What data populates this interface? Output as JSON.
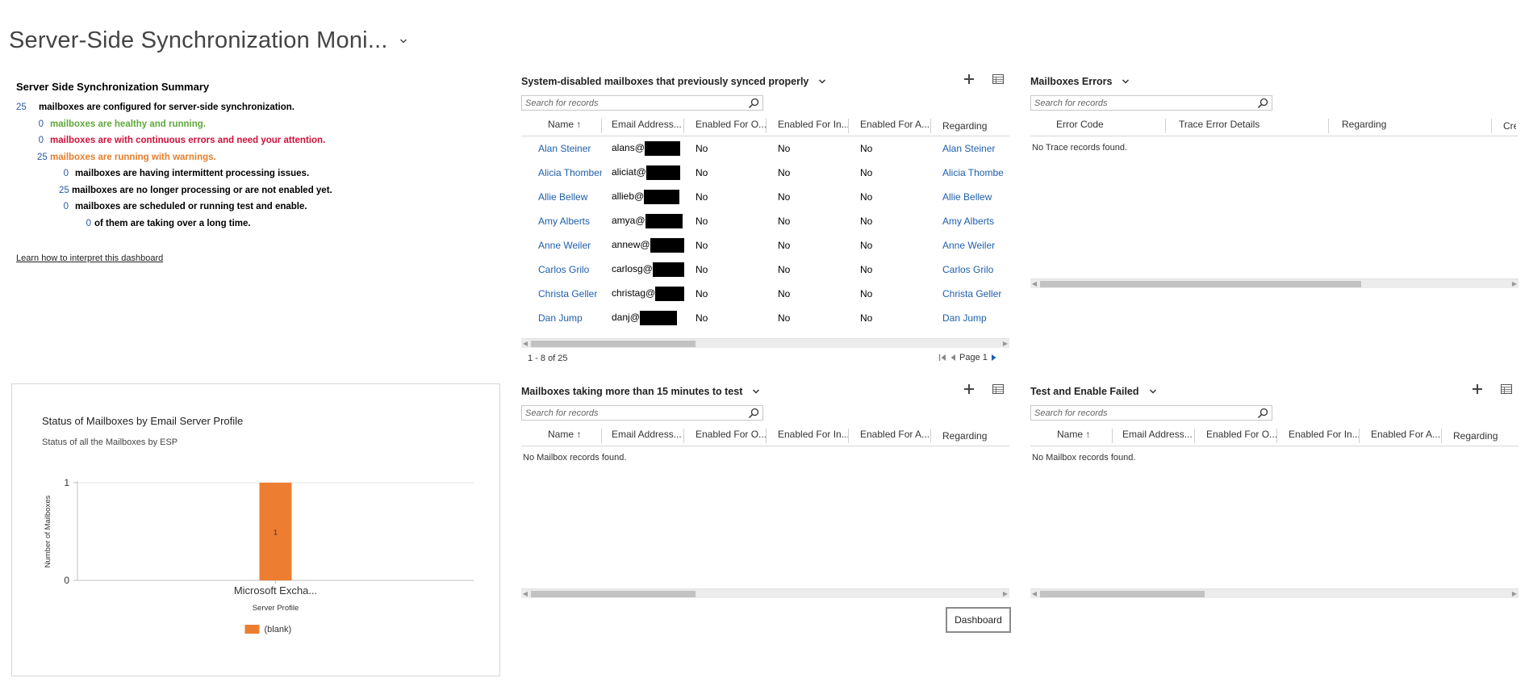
{
  "page": {
    "title": "Server-Side Synchronization Moni..."
  },
  "summary": {
    "title": "Server Side Synchronization Summary",
    "rows": [
      {
        "num": "25",
        "text": "mailboxes are configured for server-side synchronization."
      },
      {
        "num": "0",
        "text": "mailboxes are healthy and running."
      },
      {
        "num": "0",
        "text": "mailboxes are with continuous errors and need your attention."
      },
      {
        "num": "25",
        "text": "mailboxes are running with warnings."
      },
      {
        "num": "0",
        "text": "mailboxes are having intermittent processing issues."
      },
      {
        "num": "25",
        "text": "mailboxes are no longer processing or are not enabled yet."
      },
      {
        "num": "0",
        "text": "mailboxes are scheduled or running test and enable."
      },
      {
        "num": "0",
        "text": "of them are taking over a long time."
      }
    ],
    "colors": {
      "healthy": "#5ea83b",
      "errors": "#d0103a",
      "warnings": "#e57e2c"
    },
    "learn_link": "Learn how to interpret this dashboard"
  },
  "chart": {
    "title": "Status of Mailboxes by Email Server Profile",
    "subtitle": "Status of all the Mailboxes by ESP"
  },
  "chart_data": {
    "type": "bar",
    "categories": [
      "Microsoft Excha..."
    ],
    "series": [
      {
        "name": "(blank)",
        "values": [
          1
        ],
        "color": "#ed7d31"
      }
    ],
    "data_labels": [
      "1"
    ],
    "xlabel": "Server Profile",
    "ylabel": "Number of Mailboxes",
    "ylim": [
      0,
      1
    ],
    "yticks": [
      "0",
      "1"
    ],
    "grid": true,
    "legend": "bottom-center"
  },
  "panel_disabled": {
    "title": "System-disabled mailboxes that previously synced properly",
    "search_placeholder": "Search for records",
    "columns": [
      "Name ↑",
      "Email Address...",
      "Enabled For O...",
      "Enabled For In...",
      "Enabled For A...",
      "Regarding"
    ],
    "rows": [
      {
        "name": "Alan Steiner",
        "email": "alans@",
        "o": "No",
        "i": "No",
        "a": "No",
        "regarding": "Alan Steiner"
      },
      {
        "name": "Alicia Thomber",
        "email": "aliciat@",
        "o": "No",
        "i": "No",
        "a": "No",
        "regarding": "Alicia Thombe"
      },
      {
        "name": "Allie Bellew",
        "email": "allieb@",
        "o": "No",
        "i": "No",
        "a": "No",
        "regarding": "Allie Bellew"
      },
      {
        "name": "Amy Alberts",
        "email": "amya@",
        "o": "No",
        "i": "No",
        "a": "No",
        "regarding": "Amy Alberts"
      },
      {
        "name": "Anne Weiler",
        "email": "annew@",
        "o": "No",
        "i": "No",
        "a": "No",
        "regarding": "Anne Weiler"
      },
      {
        "name": "Carlos Grilo",
        "email": "carlosg@",
        "o": "No",
        "i": "No",
        "a": "No",
        "regarding": "Carlos Grilo"
      },
      {
        "name": "Christa Geller",
        "email": "christag@",
        "o": "No",
        "i": "No",
        "a": "No",
        "regarding": "Christa Geller"
      },
      {
        "name": "Dan Jump",
        "email": "danj@",
        "o": "No",
        "i": "No",
        "a": "No",
        "regarding": "Dan Jump"
      }
    ],
    "pager_count": "1 - 8 of 25",
    "pager_page": "Page 1"
  },
  "panel_errors": {
    "title": "Mailboxes Errors",
    "search_placeholder": "Search for records",
    "columns": [
      "Error Code",
      "Trace Error Details",
      "Regarding",
      "Cre"
    ],
    "empty": "No Trace records found."
  },
  "panel_slow": {
    "title": "Mailboxes taking more than 15 minutes to test",
    "search_placeholder": "Search for records",
    "columns": [
      "Name ↑",
      "Email Address...",
      "Enabled For O...",
      "Enabled For In...",
      "Enabled For A...",
      "Regarding"
    ],
    "empty": "No Mailbox records found."
  },
  "panel_failed": {
    "title": "Test and Enable Failed",
    "search_placeholder": "Search for records",
    "columns": [
      "Name ↑",
      "Email Address...",
      "Enabled For O...",
      "Enabled For In...",
      "Enabled For A...",
      "Regarding"
    ],
    "empty": "No Mailbox records found."
  },
  "dashboard_button": "Dashboard"
}
